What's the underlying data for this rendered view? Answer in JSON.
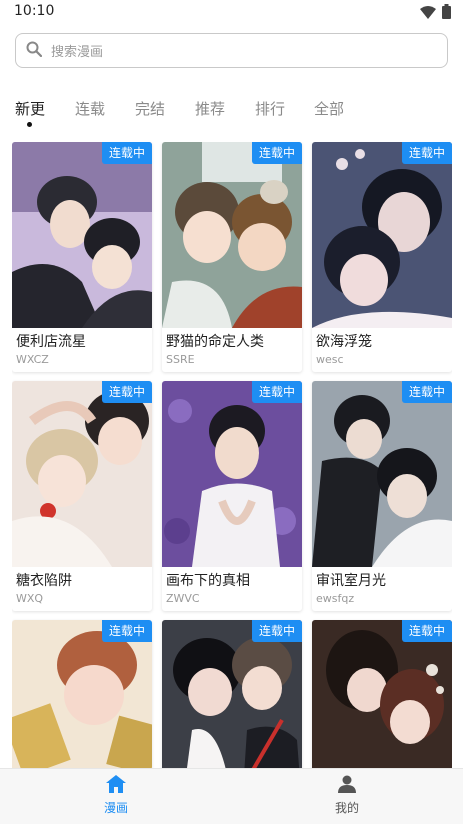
{
  "status_bar": {
    "time": "10:10"
  },
  "search": {
    "placeholder": "搜索漫画"
  },
  "tabs": [
    {
      "label": "新更",
      "active": true
    },
    {
      "label": "连载",
      "active": false
    },
    {
      "label": "完结",
      "active": false
    },
    {
      "label": "推荐",
      "active": false
    },
    {
      "label": "排行",
      "active": false
    },
    {
      "label": "全部",
      "active": false
    }
  ],
  "comics": [
    {
      "title": "便利店流星",
      "author": "WXCZ",
      "badge": "连载中"
    },
    {
      "title": "野猫的命定人类",
      "author": "SSRE",
      "badge": "连载中"
    },
    {
      "title": "欲海浮笼",
      "author": "wesc",
      "badge": "连载中"
    },
    {
      "title": "糖衣陷阱",
      "author": "WXQ",
      "badge": "连载中"
    },
    {
      "title": "画布下的真相",
      "author": "ZWVC",
      "badge": "连载中"
    },
    {
      "title": "审讯室月光",
      "author": "ewsfqz",
      "badge": "连载中"
    },
    {
      "title": "",
      "author": "",
      "badge": "连载中"
    },
    {
      "title": "",
      "author": "",
      "badge": "连载中"
    },
    {
      "title": "",
      "author": "",
      "badge": "连载中"
    }
  ],
  "bottom_nav": [
    {
      "label": "漫画",
      "icon": "home-icon",
      "active": true
    },
    {
      "label": "我的",
      "icon": "person-icon",
      "active": false
    }
  ],
  "colors": {
    "accent": "#1e8ef3"
  }
}
